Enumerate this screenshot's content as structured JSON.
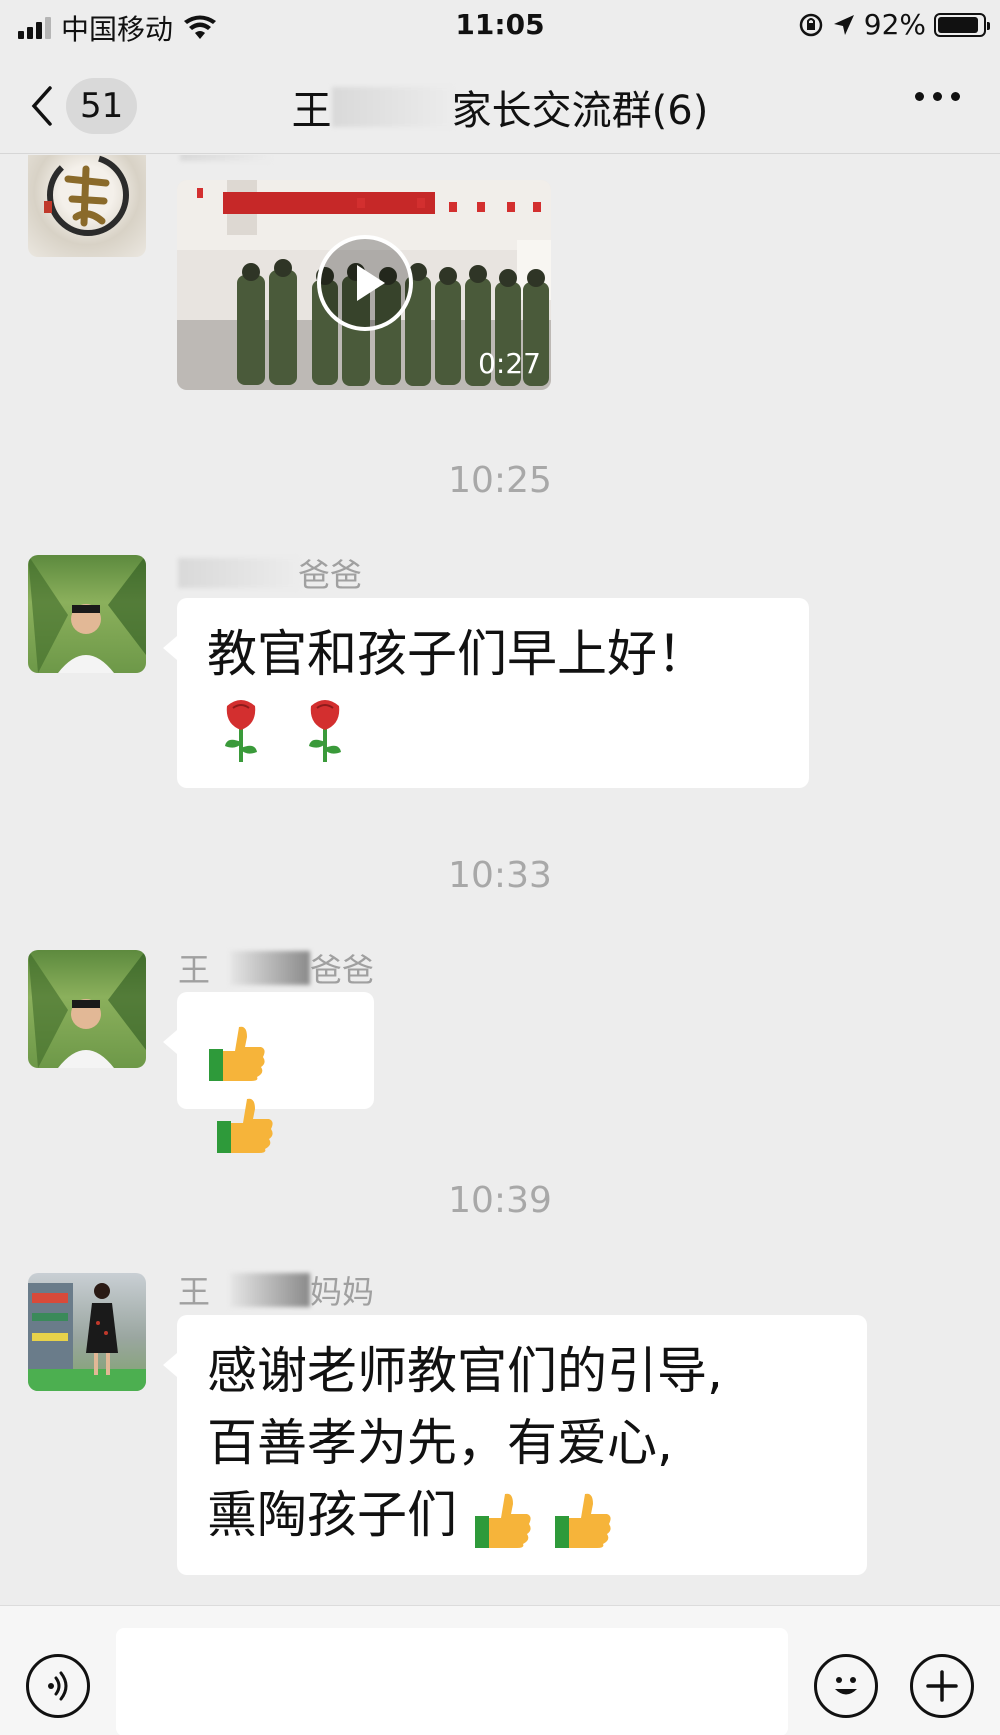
{
  "status_bar": {
    "carrier": "中国移动",
    "time": "11:05",
    "battery": "92%",
    "battery_level": 0.92
  },
  "nav": {
    "unread_count": "51",
    "title_prefix": "王",
    "title_suffix": "家长交流群(6)"
  },
  "messages": [
    {
      "type": "video",
      "duration": "0:27",
      "avatar_icon": "calligraphy-avatar"
    },
    {
      "type": "time",
      "text": "10:25"
    },
    {
      "type": "text",
      "sender_visible": "爸爸",
      "text": "教官和孩子们早上好！",
      "emoji": [
        "rose",
        "rose"
      ]
    },
    {
      "type": "time",
      "text": "10:33"
    },
    {
      "type": "text",
      "sender_prefix": "王",
      "sender_visible": "爸爸",
      "emoji": [
        "thumbs-up",
        "thumbs-up"
      ]
    },
    {
      "type": "time",
      "text": "10:39"
    },
    {
      "type": "text",
      "sender_prefix": "王",
      "sender_visible": "妈妈",
      "lines": [
        "感谢老师教官们的引导,",
        "百善孝为先，有爱心,",
        "熏陶孩子们"
      ],
      "emoji": [
        "thumbs-up",
        "thumbs-up"
      ]
    }
  ],
  "input_bar": {
    "placeholder": ""
  }
}
